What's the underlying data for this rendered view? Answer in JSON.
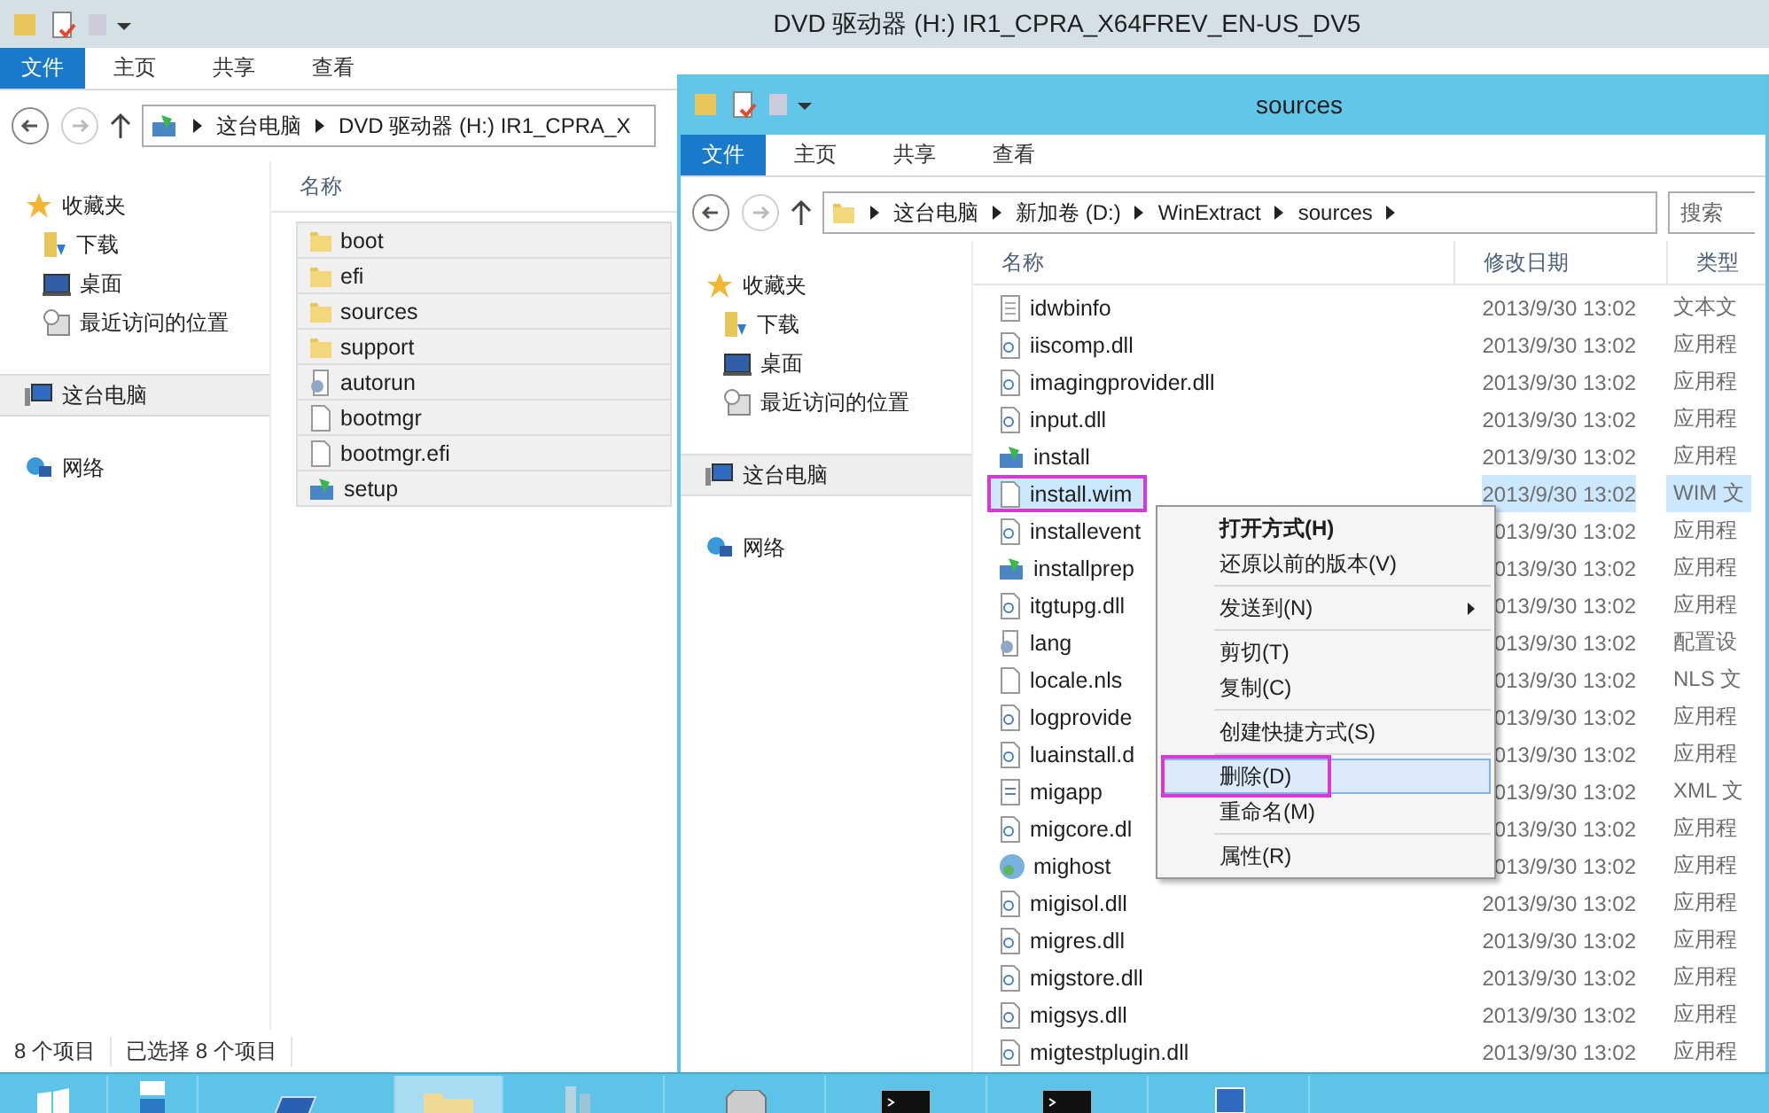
{
  "back_window": {
    "title": "DVD 驱动器 (H:) IR1_CPRA_X64FREV_EN-US_DV5",
    "tabs": [
      {
        "label": "文件",
        "selected": true
      },
      {
        "label": "主页",
        "selected": false
      },
      {
        "label": "共享",
        "selected": false
      },
      {
        "label": "查看",
        "selected": false
      }
    ],
    "address": [
      "这台电脑",
      "DVD 驱动器 (H:) IR1_CPRA_X"
    ],
    "nav": [
      {
        "label": "收藏夹",
        "kind": "star",
        "selected": false
      },
      {
        "label": "下载",
        "kind": "download",
        "selected": false
      },
      {
        "label": "桌面",
        "kind": "desktop",
        "selected": false
      },
      {
        "label": "最近访问的位置",
        "kind": "recent",
        "selected": false
      },
      {
        "label": "这台电脑",
        "kind": "computer",
        "selected": true
      },
      {
        "label": "网络",
        "kind": "network",
        "selected": false
      }
    ],
    "columns": [
      "名称"
    ],
    "rows": [
      {
        "name": "boot",
        "kind": "folder",
        "selected": true
      },
      {
        "name": "efi",
        "kind": "folder",
        "selected": true
      },
      {
        "name": "sources",
        "kind": "folder",
        "selected": true
      },
      {
        "name": "support",
        "kind": "folder",
        "selected": true
      },
      {
        "name": "autorun",
        "kind": "config",
        "selected": true
      },
      {
        "name": "bootmgr",
        "kind": "blank",
        "selected": true
      },
      {
        "name": "bootmgr.efi",
        "kind": "blank",
        "selected": true
      },
      {
        "name": "setup",
        "kind": "setup",
        "selected": true
      }
    ],
    "status_bar": [
      "8 个项目",
      "已选择 8 个项目"
    ]
  },
  "front_window": {
    "title": "sources",
    "tabs": [
      {
        "label": "文件",
        "selected": true
      },
      {
        "label": "主页",
        "selected": false
      },
      {
        "label": "共享",
        "selected": false
      },
      {
        "label": "查看",
        "selected": false
      }
    ],
    "address": [
      "这台电脑",
      "新加卷 (D:)",
      "WinExtract",
      "sources"
    ],
    "search": {
      "placeholder": "搜索"
    },
    "nav": [
      {
        "label": "收藏夹",
        "kind": "star",
        "selected": false
      },
      {
        "label": "下载",
        "kind": "download",
        "selected": false
      },
      {
        "label": "桌面",
        "kind": "desktop",
        "selected": false
      },
      {
        "label": "最近访问的位置",
        "kind": "recent",
        "selected": false
      },
      {
        "label": "这台电脑",
        "kind": "computer",
        "selected": true
      },
      {
        "label": "网络",
        "kind": "network",
        "selected": false
      }
    ],
    "columns": [
      "名称",
      "修改日期",
      "类型"
    ],
    "rows": [
      {
        "name": "idwbinfo",
        "kind": "text",
        "date": "2013/9/30 13:02",
        "type": "文本文",
        "selected": false,
        "annotated": false
      },
      {
        "name": "iiscomp.dll",
        "kind": "dll",
        "date": "2013/9/30 13:02",
        "type": "应用程",
        "selected": false,
        "annotated": false
      },
      {
        "name": "imagingprovider.dll",
        "kind": "dll",
        "date": "2013/9/30 13:02",
        "type": "应用程",
        "selected": false,
        "annotated": false
      },
      {
        "name": "input.dll",
        "kind": "dll",
        "date": "2013/9/30 13:02",
        "type": "应用程",
        "selected": false,
        "annotated": false
      },
      {
        "name": "install",
        "kind": "setup",
        "date": "2013/9/30 13:02",
        "type": "应用程",
        "selected": false,
        "annotated": false
      },
      {
        "name": "install.wim",
        "kind": "blank",
        "date": "2013/9/30 13:02",
        "type": "WIM 文",
        "selected": true,
        "annotated": true
      },
      {
        "name": "installevent",
        "kind": "dll",
        "date": "013/9/30 13:02",
        "type": "应用程",
        "selected": false,
        "annotated": false
      },
      {
        "name": "installprep",
        "kind": "setup",
        "date": "013/9/30 13:02",
        "type": "应用程",
        "selected": false,
        "annotated": false
      },
      {
        "name": "itgtupg.dll",
        "kind": "dll",
        "date": "013/9/30 13:02",
        "type": "应用程",
        "selected": false,
        "annotated": false
      },
      {
        "name": "lang",
        "kind": "config",
        "date": "013/9/30 13:02",
        "type": "配置设",
        "selected": false,
        "annotated": false
      },
      {
        "name": "locale.nls",
        "kind": "blank",
        "date": "013/9/30 13:02",
        "type": "NLS 文",
        "selected": false,
        "annotated": false
      },
      {
        "name": "logprovide",
        "kind": "dll",
        "date": "013/9/30 13:02",
        "type": "应用程",
        "selected": false,
        "annotated": false
      },
      {
        "name": "luainstall.d",
        "kind": "dll",
        "date": "013/9/30 13:02",
        "type": "应用程",
        "selected": false,
        "annotated": false
      },
      {
        "name": "migapp",
        "kind": "xml",
        "date": "013/9/30 13:02",
        "type": "XML 文",
        "selected": false,
        "annotated": false
      },
      {
        "name": "migcore.dl",
        "kind": "dll",
        "date": "013/9/30 13:02",
        "type": "应用程",
        "selected": false,
        "annotated": false
      },
      {
        "name": "mighost",
        "kind": "host",
        "date": "013/9/30 13:02",
        "type": "应用程",
        "selected": false,
        "annotated": false
      },
      {
        "name": "migisol.dll",
        "kind": "dll",
        "date": "2013/9/30 13:02",
        "type": "应用程",
        "selected": false,
        "annotated": false
      },
      {
        "name": "migres.dll",
        "kind": "dll",
        "date": "2013/9/30 13:02",
        "type": "应用程",
        "selected": false,
        "annotated": false
      },
      {
        "name": "migstore.dll",
        "kind": "dll",
        "date": "2013/9/30 13:02",
        "type": "应用程",
        "selected": false,
        "annotated": false
      },
      {
        "name": "migsys.dll",
        "kind": "dll",
        "date": "2013/9/30 13:02",
        "type": "应用程",
        "selected": false,
        "annotated": false
      },
      {
        "name": "migtestplugin.dll",
        "kind": "dll",
        "date": "2013/9/30 13:02",
        "type": "应用程",
        "selected": false,
        "annotated": false
      }
    ]
  },
  "context_menu": [
    {
      "label": "打开方式(H)",
      "kind": "default",
      "selected": false,
      "annotated": false
    },
    {
      "label": "还原以前的版本(V)",
      "kind": "item",
      "selected": false,
      "annotated": false
    },
    {
      "kind": "separator"
    },
    {
      "label": "发送到(N)",
      "kind": "submenu",
      "selected": false,
      "annotated": false
    },
    {
      "kind": "separator"
    },
    {
      "label": "剪切(T)",
      "kind": "item",
      "selected": false,
      "annotated": false
    },
    {
      "label": "复制(C)",
      "kind": "item",
      "selected": false,
      "annotated": false
    },
    {
      "kind": "separator"
    },
    {
      "label": "创建快捷方式(S)",
      "kind": "item",
      "selected": false,
      "annotated": false
    },
    {
      "kind": "separator"
    },
    {
      "label": "删除(D)",
      "kind": "item",
      "selected": true,
      "annotated": true
    },
    {
      "label": "重命名(M)",
      "kind": "item",
      "selected": false,
      "annotated": false
    },
    {
      "kind": "separator"
    },
    {
      "label": "属性(R)",
      "kind": "item",
      "selected": false,
      "annotated": false
    }
  ],
  "taskbar": [
    {
      "kind": "start",
      "selected": false
    },
    {
      "kind": "server",
      "selected": false
    },
    {
      "kind": "shell",
      "selected": false
    },
    {
      "kind": "explorer",
      "selected": true
    },
    {
      "kind": "tools",
      "selected": false
    },
    {
      "kind": "drive",
      "selected": false
    },
    {
      "kind": "console",
      "selected": false
    },
    {
      "kind": "console",
      "selected": false
    },
    {
      "kind": "display",
      "selected": false
    }
  ]
}
